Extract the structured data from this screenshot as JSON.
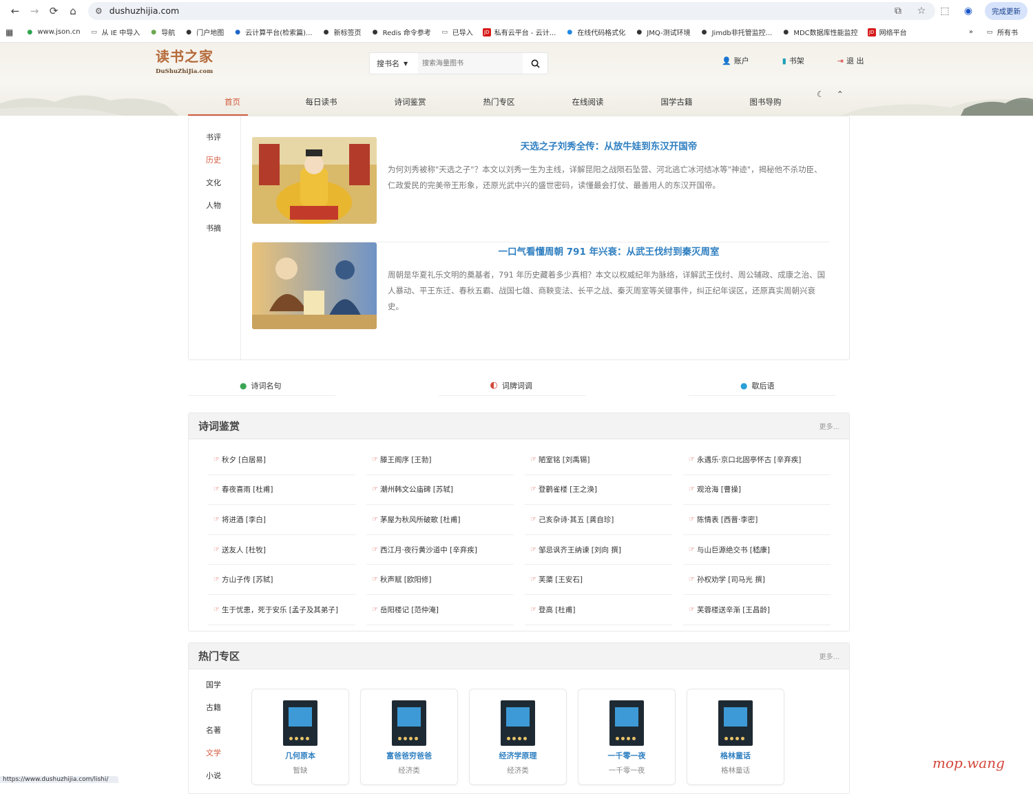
{
  "browser": {
    "url": "dushuzhijia.com",
    "update_label": "完成更新",
    "bookmarks": [
      {
        "label": "www.json.cn",
        "icon": "json-icon",
        "color": "#2ea44f"
      },
      {
        "label": "从 IE 中导入",
        "icon": "folder-icon",
        "color": "#555555"
      },
      {
        "label": "导航",
        "icon": "nav-icon",
        "color": "#6aa84f"
      },
      {
        "label": "门户地图",
        "icon": "map-icon",
        "color": "#333333"
      },
      {
        "label": "云计算平台(检索篇)...",
        "icon": "cloud-icon",
        "color": "#1e66c8"
      },
      {
        "label": "新标签页",
        "icon": "globe-icon",
        "color": "#333333"
      },
      {
        "label": "Redis 命令参考",
        "icon": "globe-icon",
        "color": "#333333"
      },
      {
        "label": "已导入",
        "icon": "folder-icon",
        "color": "#555555"
      },
      {
        "label": "私有云平台 - 云计...",
        "icon": "jd-icon",
        "color": "#d71a1a"
      },
      {
        "label": "在线代码格式化",
        "icon": "code-icon",
        "color": "#1e88e5"
      },
      {
        "label": "JMQ-测试环境",
        "icon": "globe-icon",
        "color": "#333333"
      },
      {
        "label": "Jimdb非托管监控...",
        "icon": "globe-icon",
        "color": "#333333"
      },
      {
        "label": "MDC数据库性能监控",
        "icon": "globe-icon",
        "color": "#333333"
      },
      {
        "label": "网络平台",
        "icon": "jd-icon",
        "color": "#d71a1a"
      }
    ],
    "all_bookmarks": "所有书",
    "status_url": "https://www.dushuzhijia.com/lishi/"
  },
  "header": {
    "logo_cn": "读书之家",
    "logo_en": "DuShuZhiJia.com",
    "search_select": "搜书名",
    "search_placeholder": "搜索海量图书",
    "user_links": [
      "账户",
      "书架",
      "退 出"
    ],
    "nav": [
      "首页",
      "每日读书",
      "诗词鉴赏",
      "热门专区",
      "在线阅读",
      "国学古籍",
      "图书导购"
    ],
    "active_nav": 0
  },
  "featured": {
    "categories": [
      "书评",
      "历史",
      "文化",
      "人物",
      "书摘"
    ],
    "active_category": 1,
    "articles": [
      {
        "title": "天选之子刘秀全传：从放牛娃到东汉开国帝",
        "desc": "为何刘秀被称\"天选之子\"？本文以刘秀一生为主线，详解昆阳之战陨石坠营、河北逃亡冰河结冰等\"神迹\"，揭秘他不杀功臣、仁政爱民的完美帝王形象，还原光武中兴的盛世密码，读懂最会打仗、最善用人的东汉开国帝。"
      },
      {
        "title": "一口气看懂周朝 791 年兴衰：从武王伐纣到秦灭周室",
        "desc": "周朝是华夏礼乐文明的奠基者，791 年历史藏着多少真相？本文以权威纪年为脉络，详解武王伐纣、周公辅政、成康之治、国人暴动、平王东迁、春秋五霸、战国七雄、商鞅变法、长平之战、秦灭周室等关键事件，纠正纪年误区，还原真实周朝兴衰史。"
      }
    ]
  },
  "quicklinks": [
    {
      "label": "诗词名句",
      "color": "#3aa655"
    },
    {
      "label": "词牌词调",
      "color": "#d24a3a"
    },
    {
      "label": "歇后语",
      "color": "#2a9fd6"
    }
  ],
  "poems": {
    "title": "诗词鉴赏",
    "more": "更多...",
    "items": [
      "秋夕 [白居易]",
      "滕王阁序 [王勃]",
      "陋室铭 [刘禹锡]",
      "永遇乐·京口北固亭怀古 [辛弃疾]",
      "春夜喜雨 [杜甫]",
      "潮州韩文公庙碑 [苏轼]",
      "登鹳雀楼 [王之涣]",
      "观沧海 [曹操]",
      "将进酒 [李白]",
      "茅屋为秋风所破歌 [杜甫]",
      "己亥杂诗·其五 [龚自珍]",
      "陈情表 [西晋·李密]",
      "送友人 [杜牧]",
      "西江月·夜行黄沙道中 [辛弃疾]",
      "邹忌讽齐王纳谏 [刘向 撰]",
      "与山巨源绝交书 [嵇康]",
      "方山子传 [苏轼]",
      "秋声赋 [欧阳修]",
      "芙蕖 [王安石]",
      "孙权劝学 [司马光 撰]",
      "生于忧患，死于安乐 [孟子及其弟子]",
      "岳阳楼记 [范仲淹]",
      "登高 [杜甫]",
      "芙蓉楼送辛渐 [王昌龄]"
    ]
  },
  "hot": {
    "title": "热门专区",
    "more": "更多...",
    "categories": [
      "国学",
      "古籍",
      "名著",
      "文学",
      "小说"
    ],
    "active_category": 3,
    "books": [
      {
        "title": "几何原本",
        "sub": "暂缺"
      },
      {
        "title": "富爸爸穷爸爸",
        "sub": "经济类"
      },
      {
        "title": "经济学原理",
        "sub": "经济类"
      },
      {
        "title": "一千零一夜",
        "sub": "一千零一夜"
      },
      {
        "title": "格林童话",
        "sub": "格林童话"
      }
    ]
  },
  "watermark": "mop.wang"
}
